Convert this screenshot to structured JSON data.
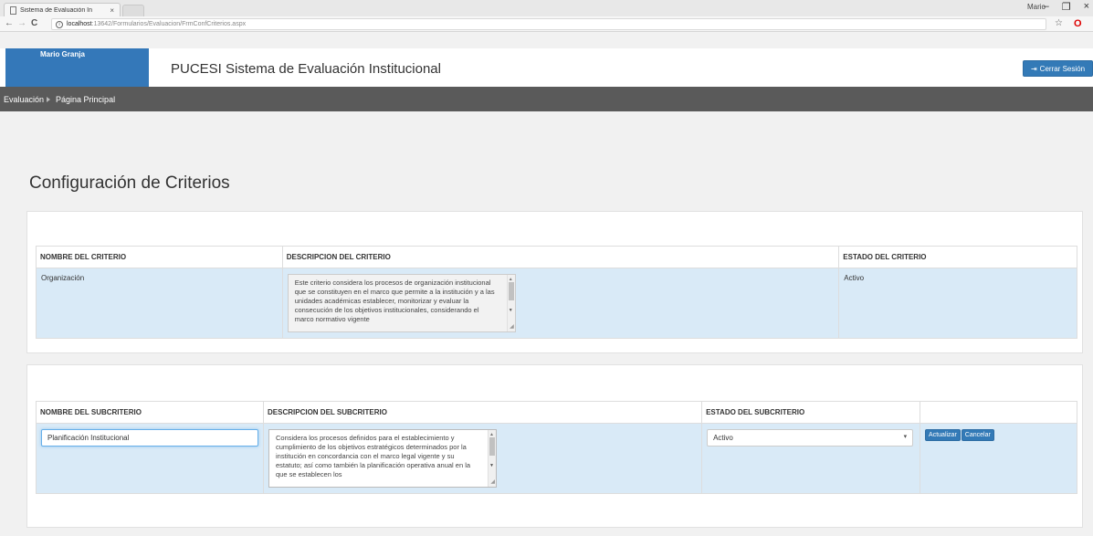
{
  "browser": {
    "tab_title": "Sistema de Evaluación In",
    "tab_close": "×",
    "url_host": "localhost",
    "url_path": ":13642/Formularios/Evaluacion/FrmConfCriterios.aspx",
    "back": "←",
    "forward": "→",
    "reload": "C",
    "info": "i",
    "star": "☆",
    "opera": "O",
    "window_user": "Mario",
    "window_buttons": [
      "–",
      "❐",
      "×"
    ]
  },
  "header": {
    "user": "Mario Granja",
    "title": "PUCESI Sistema de Evaluación Institucional",
    "logout": "Cerrar Sesión",
    "logout_icon": "⇥"
  },
  "menu": {
    "items": [
      "Evaluación",
      "Página Principal"
    ]
  },
  "page": {
    "heading": "Configuración de Criterios"
  },
  "criteria_table": {
    "headers": [
      "NOMBRE DEL CRITERIO",
      "DESCRIPCION DEL CRITERIO",
      "ESTADO DEL CRITERIO"
    ],
    "row": {
      "name": "Organización",
      "description": "Este criterio considera los procesos  de organización institucional que se constituyen en el marco que permite a la institución y a las unidades académicas establecer, monitorizar y evaluar la consecución de los objetivos institucionales, considerando el marco normativo vigente",
      "status": "Activo"
    }
  },
  "subcriteria_table": {
    "headers": [
      "NOMBRE DEL SUBCRITERIO",
      "DESCRIPCION DEL SUBCRITERIO",
      "ESTADO DEL SUBCRITERIO",
      ""
    ],
    "row": {
      "name": "Planificación Institucional",
      "description": "Considera los procesos definidos para el establecimiento y cumplimiento de los objetivos estratégicos determinados por la institución en concordancia con el marco legal vigente y su estatuto; así como también la planificación operativa anual en la que se establecen los",
      "status": "Activo",
      "update_label": "Actualizar",
      "cancel_label": "Cancelar"
    }
  },
  "colors": {
    "accent": "#337ab7",
    "user_box": "#3478b9",
    "menu_bar": "#5a5a5a",
    "row_highlight": "#d9eaf7"
  }
}
